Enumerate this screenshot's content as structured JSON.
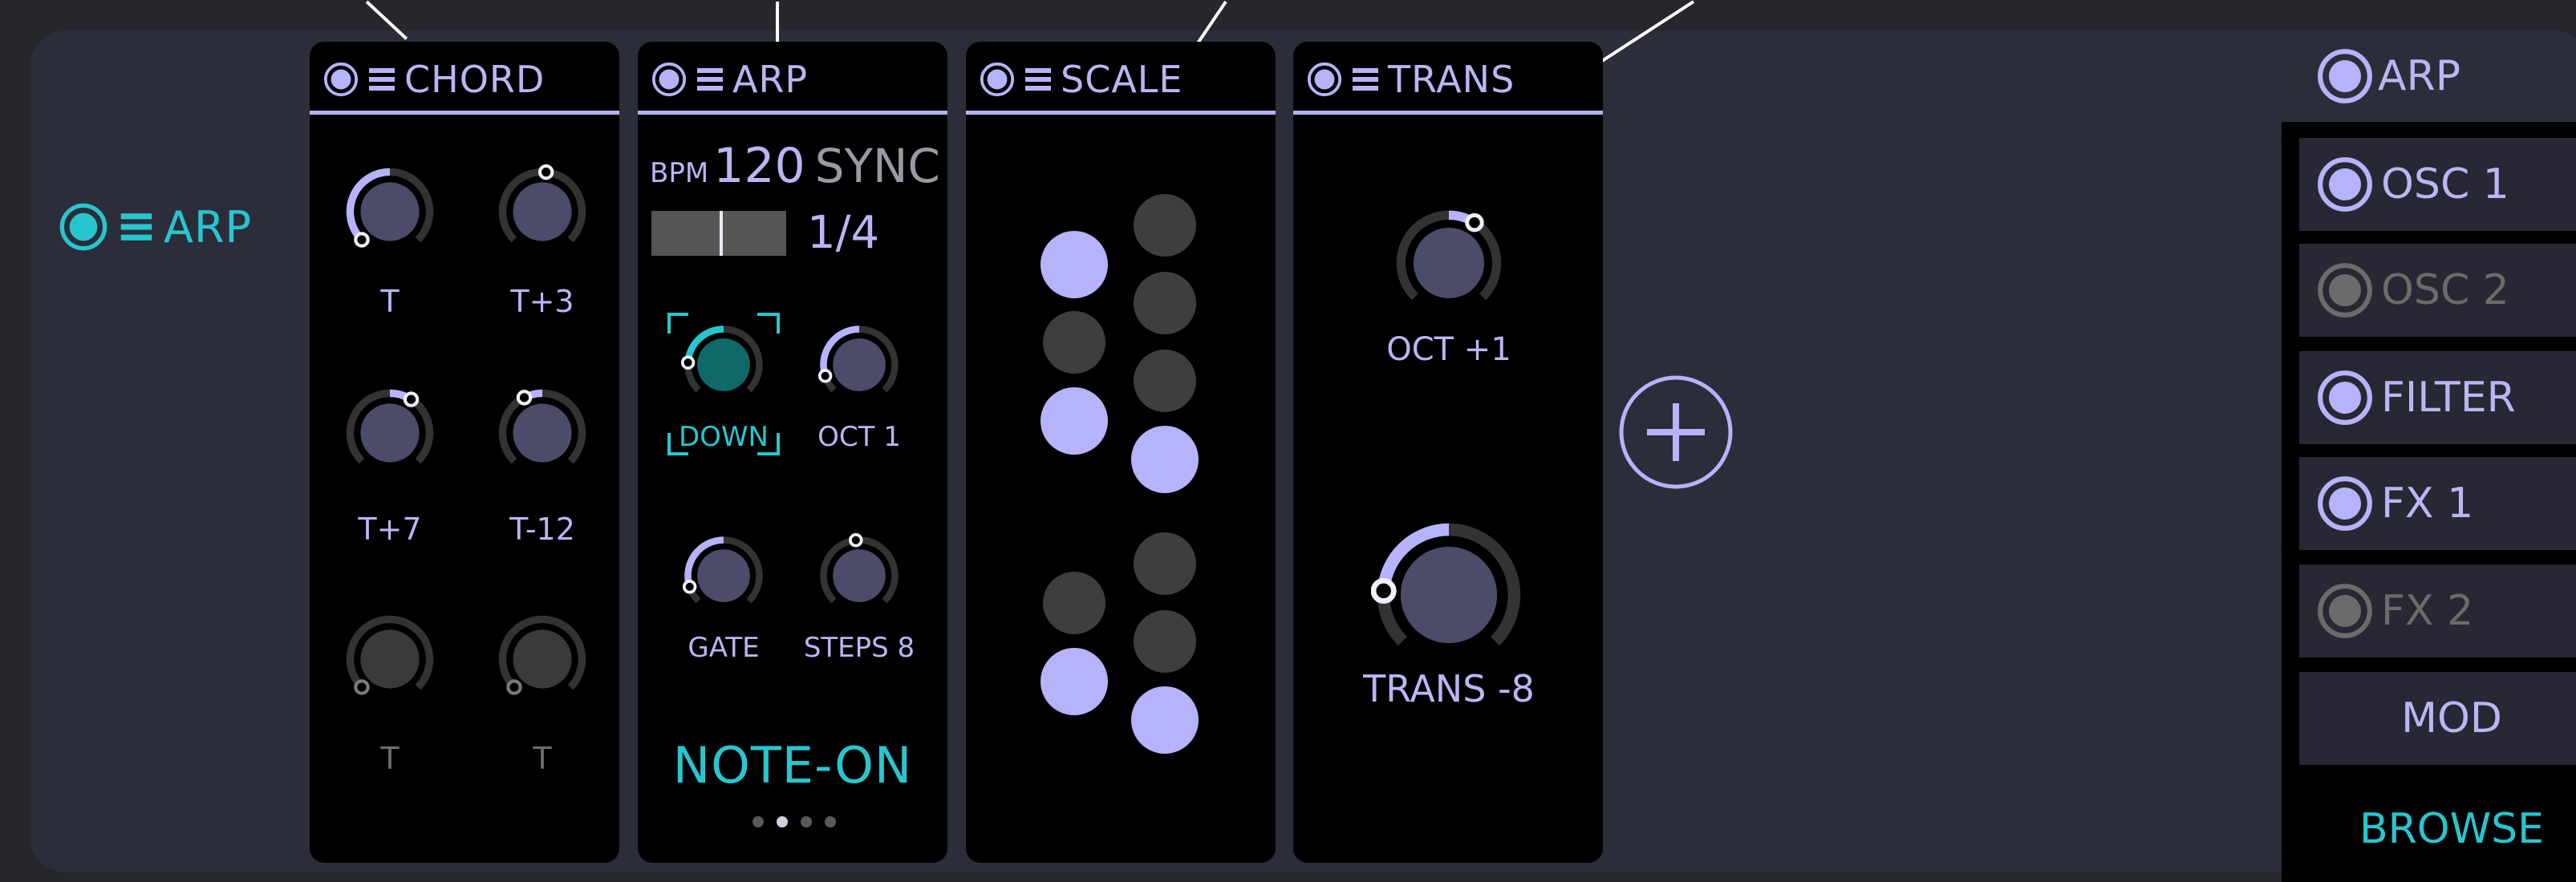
{
  "chain": {
    "label": "ARP",
    "icons": [
      "power-icon",
      "menu-icon"
    ]
  },
  "colors": {
    "accent_cyan": "#27c6cf",
    "lavender": "#b6b3fa",
    "panel": "#000000",
    "frame": "#2c2d3a",
    "background": "#26272c",
    "dim": "#6b6b6b"
  },
  "panels": {
    "chord": {
      "title": "CHORD",
      "knobs": [
        {
          "label": "T",
          "active": true,
          "value": 0.0
        },
        {
          "label": "T+3",
          "active": true,
          "value": 0.52
        },
        {
          "label": "T+7",
          "active": true,
          "value": 0.62
        },
        {
          "label": "T-12",
          "active": true,
          "value": 0.4
        },
        {
          "label": "T",
          "active": false,
          "value": 0.0
        },
        {
          "label": "T",
          "active": false,
          "value": 0.0
        }
      ]
    },
    "arp": {
      "title": "ARP",
      "bpm_label": "BPM",
      "bpm_value": "120",
      "sync": "SYNC",
      "rate": "1/4",
      "knobs": [
        {
          "label": "DOWN",
          "value": 0.18
        },
        {
          "label": "OCT 1",
          "value": 0.1
        },
        {
          "label": "GATE",
          "value": 0.1
        },
        {
          "label": "STEPS 8",
          "value": 0.48
        }
      ],
      "trigger": "NOTE-ON",
      "page": 2,
      "pages": 4
    },
    "scale": {
      "title": "SCALE",
      "dots": [
        {
          "col": 0,
          "row": 1,
          "on": true
        },
        {
          "col": 0,
          "row": 2,
          "on": false
        },
        {
          "col": 0,
          "row": 3,
          "on": true
        },
        {
          "col": 1,
          "row": 0,
          "on": false
        },
        {
          "col": 1,
          "row": 1,
          "on": false
        },
        {
          "col": 1,
          "row": 2,
          "on": false
        },
        {
          "col": 1,
          "row": 3,
          "on": true
        },
        {
          "col": 0,
          "row": 5,
          "on": false
        },
        {
          "col": 0,
          "row": 6,
          "on": true
        },
        {
          "col": 1,
          "row": 4,
          "on": false
        },
        {
          "col": 1,
          "row": 5,
          "on": false
        },
        {
          "col": 1,
          "row": 6,
          "on": true
        }
      ]
    },
    "trans": {
      "title": "TRANS",
      "knobs": [
        {
          "label": "OCT +1",
          "value": 0.62
        },
        {
          "label": "TRANS -8",
          "value": 0.18
        }
      ]
    }
  },
  "add_button": {
    "icon": "plus-icon"
  },
  "sidebar": {
    "top": {
      "label": "ARP"
    },
    "items": [
      {
        "label": "OSC 1",
        "enabled": true
      },
      {
        "label": "OSC 2",
        "enabled": false
      },
      {
        "label": "FILTER",
        "enabled": true
      },
      {
        "label": "FX 1",
        "enabled": true
      },
      {
        "label": "FX 2",
        "enabled": false
      }
    ],
    "mod": "MOD",
    "browse": "BROWSE"
  }
}
